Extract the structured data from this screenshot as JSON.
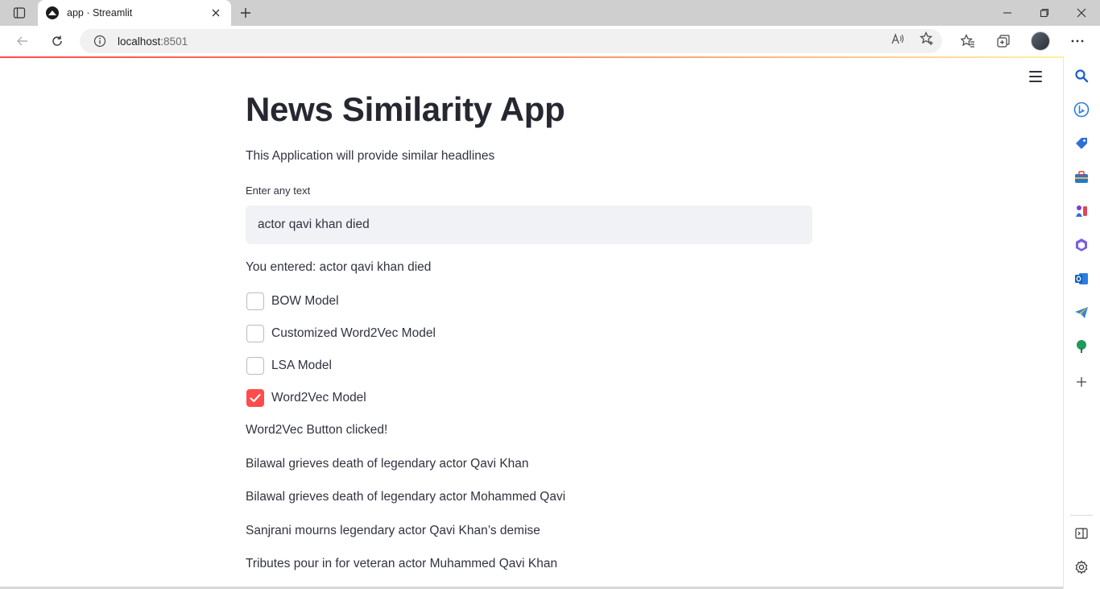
{
  "browser": {
    "tab_title": "app · Streamlit",
    "url_host": "localhost",
    "url_port": ":8501"
  },
  "app": {
    "title": "News Similarity App",
    "description": "This Application will provide similar headlines",
    "input_label": "Enter any text",
    "input_value": "actor qavi khan died",
    "entered_text": "You entered: actor qavi khan died",
    "checkboxes": [
      {
        "label": "BOW Model",
        "checked": false
      },
      {
        "label": "Customized Word2Vec Model",
        "checked": false
      },
      {
        "label": "LSA Model",
        "checked": false
      },
      {
        "label": "Word2Vec Model",
        "checked": true
      }
    ],
    "status_message": "Word2Vec Button clicked!",
    "results": [
      "Bilawal grieves death of legendary actor Qavi Khan",
      "Bilawal grieves death of legendary actor Mohammed Qavi",
      "Sanjrani mourns legendary actor Qavi Khan’s demise",
      "Tributes pour in for veteran actor Muhammed Qavi Khan"
    ]
  },
  "colors": {
    "accent": "#ff4b4b",
    "text": "#31333f",
    "input_bg": "#f0f2f6"
  }
}
